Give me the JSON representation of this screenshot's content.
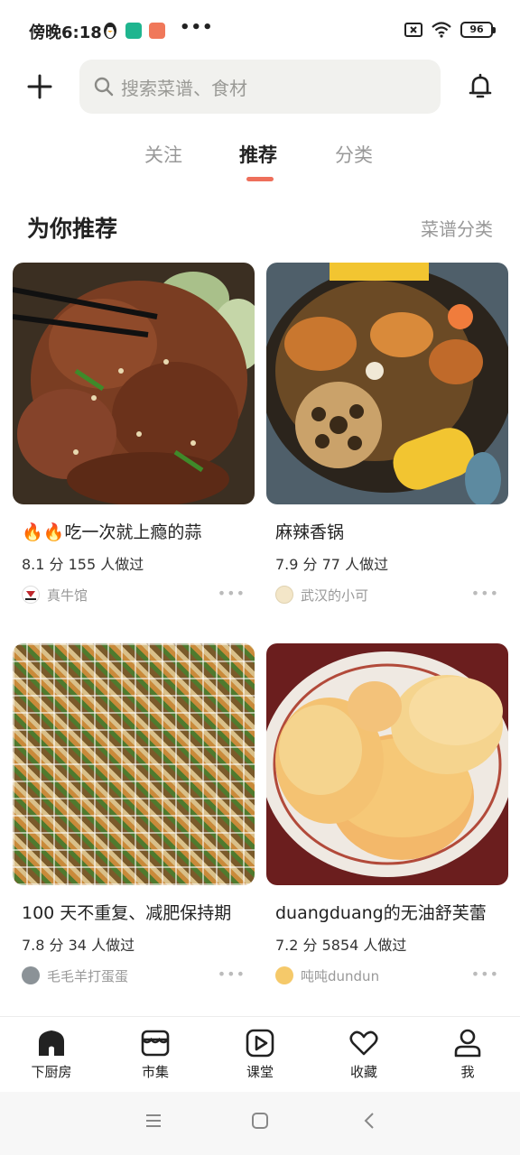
{
  "status": {
    "time": "傍晚6:18",
    "more": "•••",
    "battery": "96"
  },
  "search": {
    "placeholder": "搜索菜谱、食材"
  },
  "tabs": [
    {
      "label": "关注"
    },
    {
      "label": "推荐"
    },
    {
      "label": "分类"
    }
  ],
  "section": {
    "title": "为你推荐",
    "link": "菜谱分类"
  },
  "cards": [
    {
      "title": "🔥🔥吃一次就上瘾的蒜",
      "stats": "8.1 分 155 人做过",
      "author": "真牛馆"
    },
    {
      "title": "麻辣香锅",
      "stats": "7.9 分 77 人做过",
      "author": "武汉的小可"
    },
    {
      "title": "100 天不重复、减肥保持期",
      "stats": "7.8 分 34 人做过",
      "author": "毛毛羊打蛋蛋"
    },
    {
      "title": "duangduang的无油舒芙蕾",
      "stats": "7.2 分 5854 人做过",
      "author": "吨吨dundun"
    }
  ],
  "nav": [
    {
      "label": "下厨房",
      "icon": "home-icon"
    },
    {
      "label": "市集",
      "icon": "market-icon"
    },
    {
      "label": "课堂",
      "icon": "play-icon"
    },
    {
      "label": "收藏",
      "icon": "heart-icon"
    },
    {
      "label": "我",
      "icon": "person-icon"
    }
  ],
  "more_dots": "•••",
  "colors": {
    "accent": "#ee6f5b",
    "search_bg": "#f1f1ee",
    "muted": "#999999"
  }
}
